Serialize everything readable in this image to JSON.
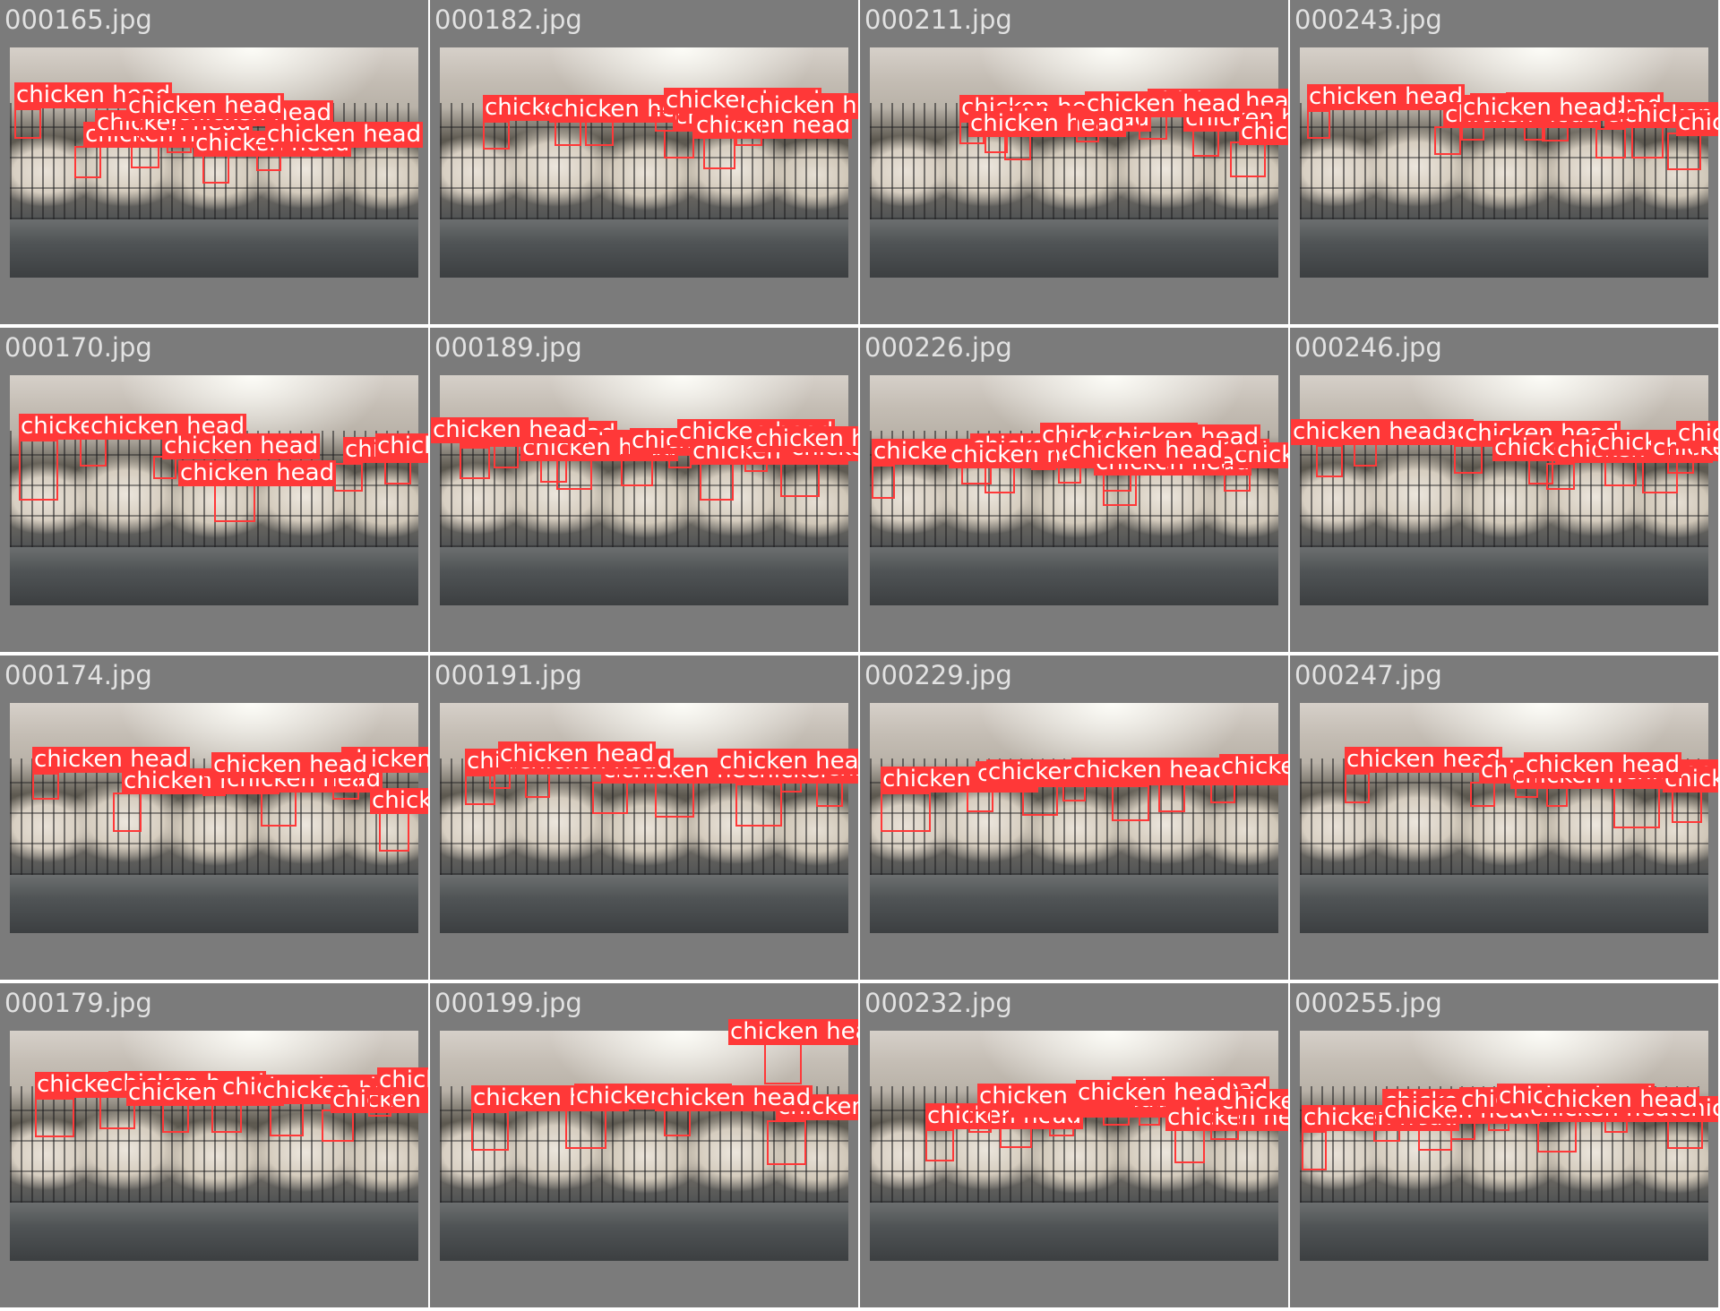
{
  "label_text": "chicken head",
  "colors": {
    "label_bg": "#ff3838",
    "label_text": "#ffffff",
    "cell_bg": "#7b7b7b",
    "filename_text": "#e2e2e2"
  },
  "tiles": [
    {
      "filename": "000165.jpg",
      "detections": 7
    },
    {
      "filename": "000182.jpg",
      "detections": 7
    },
    {
      "filename": "000211.jpg",
      "detections": 7
    },
    {
      "filename": "000243.jpg",
      "detections": 8
    },
    {
      "filename": "000170.jpg",
      "detections": 6
    },
    {
      "filename": "000189.jpg",
      "detections": 9
    },
    {
      "filename": "000226.jpg",
      "detections": 9
    },
    {
      "filename": "000246.jpg",
      "detections": 8
    },
    {
      "filename": "000174.jpg",
      "detections": 6
    },
    {
      "filename": "000191.jpg",
      "detections": 8
    },
    {
      "filename": "000229.jpg",
      "detections": 7
    },
    {
      "filename": "000247.jpg",
      "detections": 6
    },
    {
      "filename": "000179.jpg",
      "detections": 7
    },
    {
      "filename": "000199.jpg",
      "detections": 5
    },
    {
      "filename": "000232.jpg",
      "detections": 8
    },
    {
      "filename": "000255.jpg",
      "detections": 8
    }
  ]
}
